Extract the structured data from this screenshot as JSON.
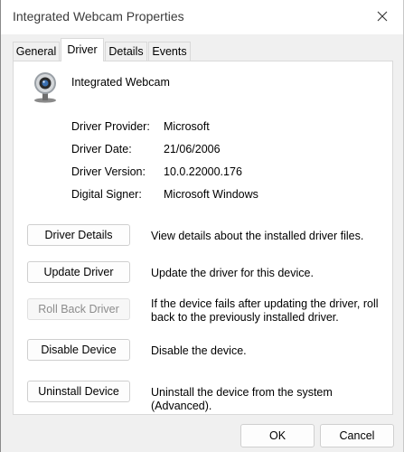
{
  "window": {
    "title": "Integrated Webcam Properties"
  },
  "tabs": [
    {
      "label": "General"
    },
    {
      "label": "Driver"
    },
    {
      "label": "Details"
    },
    {
      "label": "Events"
    }
  ],
  "active_tab": "Driver",
  "device": {
    "name": "Integrated Webcam",
    "icon": "webcam-icon"
  },
  "driver_info": [
    {
      "label": "Driver Provider:",
      "value": "Microsoft"
    },
    {
      "label": "Driver Date:",
      "value": "21/06/2006"
    },
    {
      "label": "Driver Version:",
      "value": "10.0.22000.176"
    },
    {
      "label": "Digital Signer:",
      "value": "Microsoft Windows"
    }
  ],
  "actions": [
    {
      "label": "Driver Details",
      "description": "View details about the installed driver files.",
      "enabled": true
    },
    {
      "label": "Update Driver",
      "description": "Update the driver for this device.",
      "enabled": true
    },
    {
      "label": "Roll Back Driver",
      "description": "If the device fails after updating the driver, roll back to the previously installed driver.",
      "enabled": false
    },
    {
      "label": "Disable Device",
      "description": "Disable the device.",
      "enabled": true
    },
    {
      "label": "Uninstall Device",
      "description": "Uninstall the device from the system (Advanced).",
      "enabled": true
    }
  ],
  "footer": {
    "ok_label": "OK",
    "cancel_label": "Cancel"
  },
  "colors": {
    "window_bg": "#f0f0f0",
    "panel_bg": "#ffffff",
    "disabled_text": "#8c8c8c"
  }
}
